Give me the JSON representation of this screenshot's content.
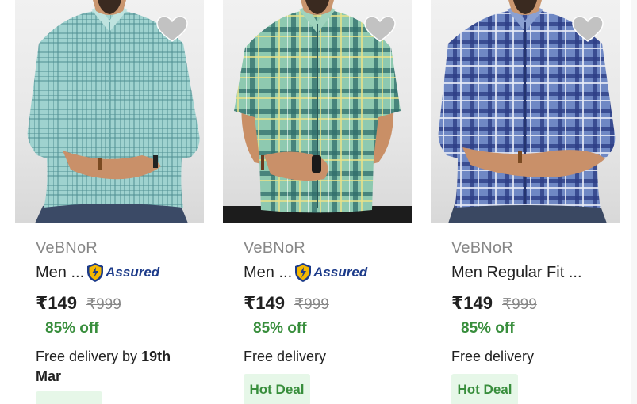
{
  "products": [
    {
      "brand": "VeBNoR",
      "title": "Men ...",
      "assured": "Assured",
      "price": "₹149",
      "mrp": "₹999",
      "discount": "85% off",
      "delivery_prefix": "Free delivery by ",
      "delivery_date": "19th",
      "delivery_line2": "Mar",
      "shirt_color": "#8fc7c4",
      "wishlisted": false
    },
    {
      "brand": "VeBNoR",
      "title": "Men ...",
      "assured": "Assured",
      "price": "₹149",
      "mrp": "₹999",
      "discount": "85% off",
      "delivery": "Free delivery",
      "deal_badge": "Hot Deal",
      "shirt_color": "#5f9e86",
      "wishlisted": false
    },
    {
      "brand": "VeBNoR",
      "title": "Men Regular Fit ...",
      "price": "₹149",
      "mrp": "₹999",
      "discount": "85% off",
      "delivery": "Free delivery",
      "deal_badge": "Hot Deal",
      "shirt_color": "#4f6fb0",
      "wishlisted": false
    }
  ],
  "colors": {
    "discount_green": "#388e3c",
    "badge_bg": "#e6f7e8",
    "muted_text": "#878787",
    "assured_blue": "#1c3b8a",
    "assured_gold": "#f5b800"
  },
  "icons": {
    "wishlist": "heart-icon",
    "assured": "assured-shield-icon"
  }
}
